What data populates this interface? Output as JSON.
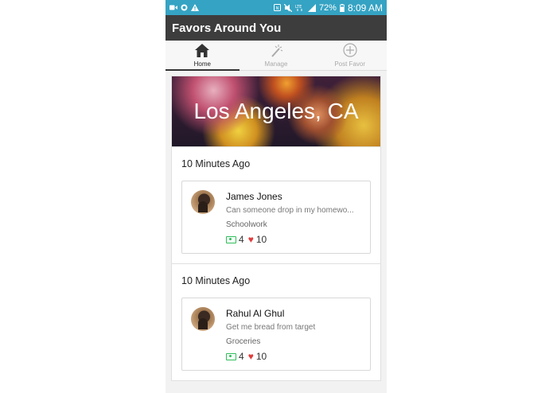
{
  "status_bar": {
    "battery": "72%",
    "time": "8:09 AM"
  },
  "app_bar": {
    "title": "Favors Around You"
  },
  "tabs": [
    {
      "label": "Home",
      "icon": "home-icon",
      "active": true
    },
    {
      "label": "Manage",
      "icon": "magic-wand-icon",
      "active": false
    },
    {
      "label": "Post Favor",
      "icon": "add-circle-icon",
      "active": false
    }
  ],
  "location": {
    "title": "Los Angeles, CA"
  },
  "feed": [
    {
      "time_label": "10 Minutes Ago",
      "name": "James Jones",
      "description": "Can someone drop in my homewo...",
      "category": "Schoolwork",
      "money": "4",
      "likes": "10"
    },
    {
      "time_label": "10 Minutes Ago",
      "name": "Rahul Al Ghul",
      "description": "Get me bread from target",
      "category": "Groceries",
      "money": "4",
      "likes": "10"
    }
  ],
  "colors": {
    "status_bar": "#35a3c3",
    "app_bar": "#3d3d3d",
    "money": "#2ebd59",
    "heart": "#e03b3b"
  }
}
